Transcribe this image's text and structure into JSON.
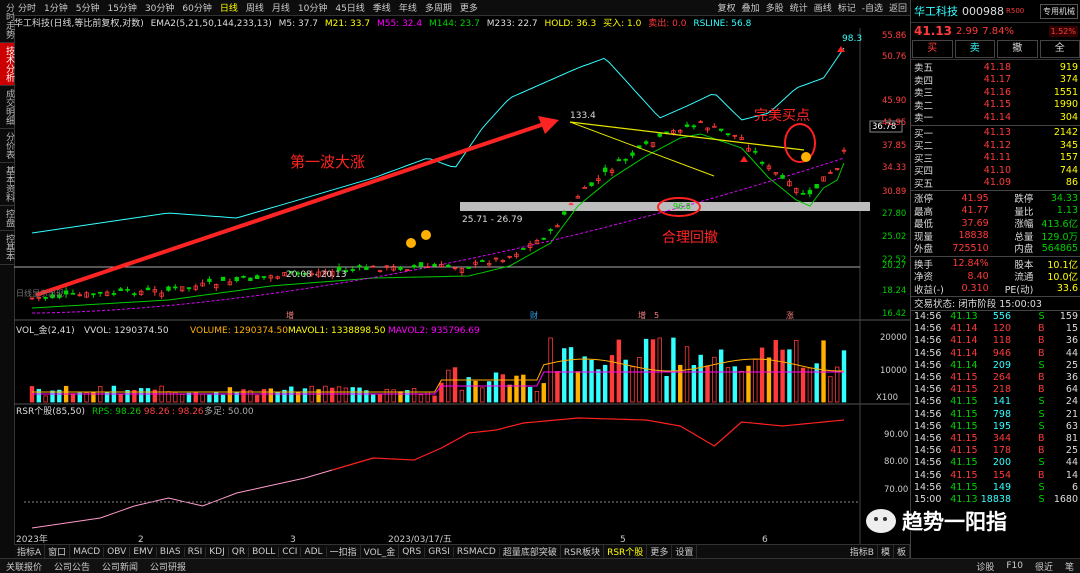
{
  "sidebar": {
    "tabs": [
      "分时走势",
      "技术分析",
      "成交明细",
      "分价表",
      "基本资料",
      "控盘",
      "控基本"
    ],
    "active": 1
  },
  "periods": [
    "分时",
    "1分钟",
    "5分钟",
    "15分钟",
    "30分钟",
    "60分钟",
    "日线",
    "周线",
    "月线",
    "10分钟",
    "45日线",
    "季线",
    "年线",
    "多周期",
    "更多"
  ],
  "active_period": "日线",
  "right_tools": [
    "复权",
    "叠加",
    "多股",
    "统计",
    "画线",
    "标记",
    "-自选",
    "返回"
  ],
  "indicator_line": {
    "title": "华工科技(日线,等比前复权,对数)",
    "ema": "EMA2(5,21,50,144,233,13)",
    "m5": "M5: 37.7",
    "m21": "M21: 33.7",
    "m55": "M55: 32.4",
    "m144": "M144: 23.7",
    "m233": "M233: 22.7",
    "hold": "HOLD: 36.3",
    "buyin": "买入: 1.0",
    "sellout": "卖出: 0.0",
    "rsline": "RSLINE: 56.8"
  },
  "annotations": {
    "wave": "第一波大涨",
    "pullback": "合理回撤",
    "perfect_buy": "完美买点",
    "zone1": "20.08 - 20.13",
    "zone2": "25.71 - 26.79",
    "peak": "133.4",
    "mid": "96.8",
    "top": "98.3",
    "price_tag": "36.78",
    "note": "日线显示出现"
  },
  "markers": [
    "增",
    "财",
    "增",
    "5",
    "涨"
  ],
  "price_axis": [
    "55.86",
    "50.76",
    "45.90",
    "41.95",
    "37.85",
    "34.33",
    "30.89",
    "27.80",
    "25.02",
    "22.52",
    "20.27",
    "18.24",
    "16.42"
  ],
  "vol_line": {
    "name": "VOL_金(2,41)",
    "vvol": "VVOL: 1290374.50",
    "volume": "VOLUME: 1290374.50",
    "mavol1": "MAVOL1: 1338898.50",
    "mavol2": "MAVOL2: 935796.69"
  },
  "vol_axis": [
    "20000",
    "10000",
    "X100"
  ],
  "rsr_line": {
    "name": "RSR个股(85,50)",
    "rps": "RPS: 98.26",
    "v2": ": 98.26",
    "v3": ": 98.26",
    "high": "多足: 50.00"
  },
  "rsr_axis": [
    "90.00",
    "80.00",
    "70.00"
  ],
  "date_axis": [
    "2023年",
    "2",
    "3",
    "2023/03/17/五",
    "5",
    "6"
  ],
  "indicator_tabs": [
    "指标A",
    "窗口",
    "MACD",
    "OBV",
    "EMV",
    "BIAS",
    "RSI",
    "KDJ",
    "QR",
    "BOLL",
    "CCI",
    "ADL",
    "一扣指",
    "VOL_金",
    "QRS",
    "GRSI",
    "RSMACD",
    "超量底部突破",
    "RSR板块",
    "RSR个股",
    "更多",
    "设置",
    "指标B",
    "模",
    "板"
  ],
  "active_indicator_tab": "RSR个股",
  "status_bar": [
    "关联报价",
    "公司公告",
    "公司新闻",
    "公司研报",
    "诊股",
    "F10",
    "很近",
    "笔"
  ],
  "stock": {
    "name": "华工科技",
    "code": "000988",
    "tag": "R500",
    "badge": "专用机械",
    "badge_pct": "1.52%",
    "price": "41.13",
    "change": "2.99",
    "pct": "7.84%"
  },
  "trade_buttons": [
    "买",
    "卖",
    "撤",
    "全"
  ],
  "asks": [
    [
      "卖五",
      "41.18",
      "919"
    ],
    [
      "卖四",
      "41.17",
      "374"
    ],
    [
      "卖三",
      "41.16",
      "1551"
    ],
    [
      "卖二",
      "41.15",
      "1990"
    ],
    [
      "卖一",
      "41.14",
      "304"
    ]
  ],
  "bids": [
    [
      "买一",
      "41.13",
      "2142"
    ],
    [
      "买二",
      "41.12",
      "345"
    ],
    [
      "买三",
      "41.11",
      "157"
    ],
    [
      "买四",
      "41.10",
      "744"
    ],
    [
      "买五",
      "41.09",
      "86"
    ]
  ],
  "stats": [
    [
      "涨停",
      "41.95",
      "跌停",
      "34.33"
    ],
    [
      "最高",
      "41.77",
      "量比",
      "1.13"
    ],
    [
      "最低",
      "37.69",
      "涨幅",
      "413.6亿"
    ],
    [
      "现量",
      "18838",
      "总量",
      "129.0万"
    ],
    [
      "外盘",
      "725510",
      "内盘",
      "564865"
    ]
  ],
  "stats2": [
    [
      "换手",
      "12.84%",
      "股本",
      "10.1亿"
    ],
    [
      "净资",
      "8.40",
      "流通",
      "10.0亿"
    ],
    [
      "收益(-)",
      "0.310",
      "PE(动)",
      "33.6"
    ]
  ],
  "trade_status": "交易状态: 闭市阶段 15:00:03",
  "ticks": [
    [
      "14:56",
      "41.13",
      "556",
      "S",
      "159"
    ],
    [
      "14:56",
      "41.14",
      "120",
      "B",
      "15"
    ],
    [
      "14:56",
      "41.14",
      "118",
      "B",
      "36"
    ],
    [
      "14:56",
      "41.14",
      "946",
      "B",
      "44"
    ],
    [
      "14:56",
      "41.14",
      "209",
      "S",
      "25"
    ],
    [
      "14:56",
      "41.15",
      "264",
      "B",
      "36"
    ],
    [
      "14:56",
      "41.15",
      "218",
      "B",
      "64"
    ],
    [
      "14:56",
      "41.15",
      "141",
      "S",
      "24"
    ],
    [
      "14:56",
      "41.15",
      "798",
      "S",
      "21"
    ],
    [
      "14:56",
      "41.15",
      "195",
      "S",
      "63"
    ],
    [
      "14:56",
      "41.15",
      "344",
      "B",
      "81"
    ],
    [
      "14:56",
      "41.15",
      "178",
      "B",
      "25"
    ],
    [
      "14:56",
      "41.15",
      "200",
      "S",
      "44"
    ],
    [
      "14:56",
      "41.15",
      "154",
      "B",
      "14"
    ],
    [
      "14:56",
      "41.15",
      "149",
      "S",
      "6"
    ],
    [
      "15:00",
      "41.13",
      "18838",
      "S",
      "1680"
    ]
  ],
  "watermark": "趋势一阳指",
  "colors": {
    "up": "#ff3a3a",
    "down": "#00d200",
    "rsline": "#3ff",
    "vol_up": "#ff3a3a",
    "vol_cyan": "#3ff",
    "vol_yellow": "#ffb000",
    "rsr": "#ff2020"
  }
}
